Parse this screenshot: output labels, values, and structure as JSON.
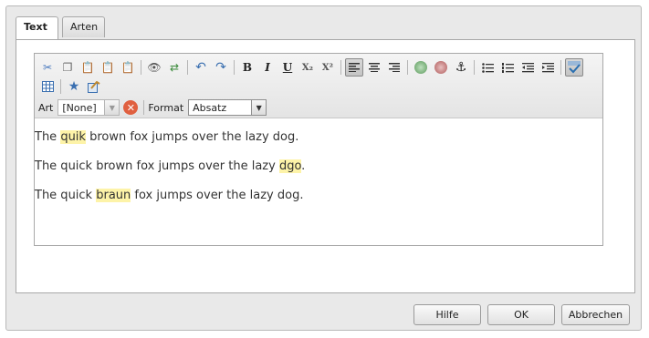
{
  "tabs": [
    {
      "label": "Text",
      "active": true
    },
    {
      "label": "Arten",
      "active": false
    }
  ],
  "toolbar": {
    "row1_icons": [
      "cut-icon",
      "copy-icon",
      "paste-icon",
      "paste-text-icon",
      "paste-word-icon",
      "find-icon",
      "replace-icon",
      "undo-icon",
      "redo-icon",
      "bold-icon",
      "italic-icon",
      "underline-icon",
      "subscript-icon",
      "superscript-icon",
      "align-left-icon",
      "align-center-icon",
      "align-right-icon",
      "link-icon",
      "unlink-icon",
      "anchor-icon",
      "bullet-list-icon",
      "numbered-list-icon",
      "outdent-icon",
      "indent-icon",
      "spellcheck-icon"
    ],
    "row2_icons": [
      "table-icon",
      "special-char-icon",
      "image-props-icon"
    ],
    "bold": "B",
    "italic": "I",
    "underline": "U",
    "subscript": "X₂",
    "superscript": "X²"
  },
  "format_bar": {
    "style_label": "Art",
    "style_value": "[None]",
    "format_label": "Format",
    "format_value": "Absatz"
  },
  "content": {
    "paragraphs": [
      {
        "before": "The ",
        "misspelled": "quik",
        "after": " brown fox jumps over the lazy dog."
      },
      {
        "before": "The quick brown fox jumps over the lazy ",
        "misspelled": "dgo",
        "after": "."
      },
      {
        "before": "The quick ",
        "misspelled": "braun",
        "after": " fox jumps over the lazy dog."
      }
    ]
  },
  "buttons": {
    "help": "Hilfe",
    "ok": "OK",
    "cancel": "Abbrechen"
  },
  "colors": {
    "misspelled_highlight": "#fdf3a8",
    "clear_button": "#e06040"
  }
}
